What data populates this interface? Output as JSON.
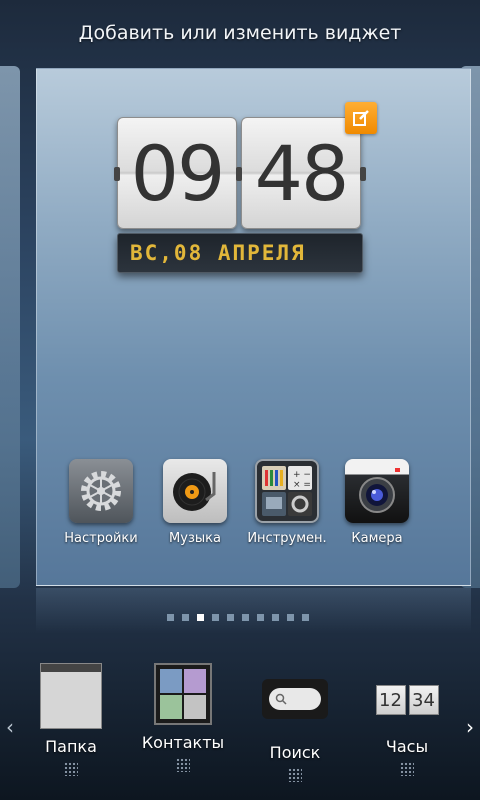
{
  "header": {
    "title": "Добавить или изменить виджет"
  },
  "clock_widget": {
    "hours": "09",
    "minutes": "48",
    "date": "ВС,08 АПРЕЛЯ"
  },
  "apps": [
    {
      "label": "Настройки",
      "icon": "gear-icon"
    },
    {
      "label": "Музыка",
      "icon": "turntable-icon"
    },
    {
      "label": "Инструмен.",
      "icon": "tools-icon"
    },
    {
      "label": "Камера",
      "icon": "camera-icon"
    }
  ],
  "pager": {
    "count": 10,
    "active_index": 2
  },
  "dock": {
    "items": [
      {
        "label": "Папка",
        "icon": "folder-widget-icon"
      },
      {
        "label": "Контакты",
        "icon": "contacts-widget-icon"
      },
      {
        "label": "Поиск",
        "icon": "search-widget-icon"
      },
      {
        "label": "Часы",
        "icon": "clock-widget-icon",
        "preview_hours": "12",
        "preview_minutes": "34"
      }
    ]
  },
  "colors": {
    "accent": "#f08a00",
    "date_text": "#e2b73a"
  }
}
